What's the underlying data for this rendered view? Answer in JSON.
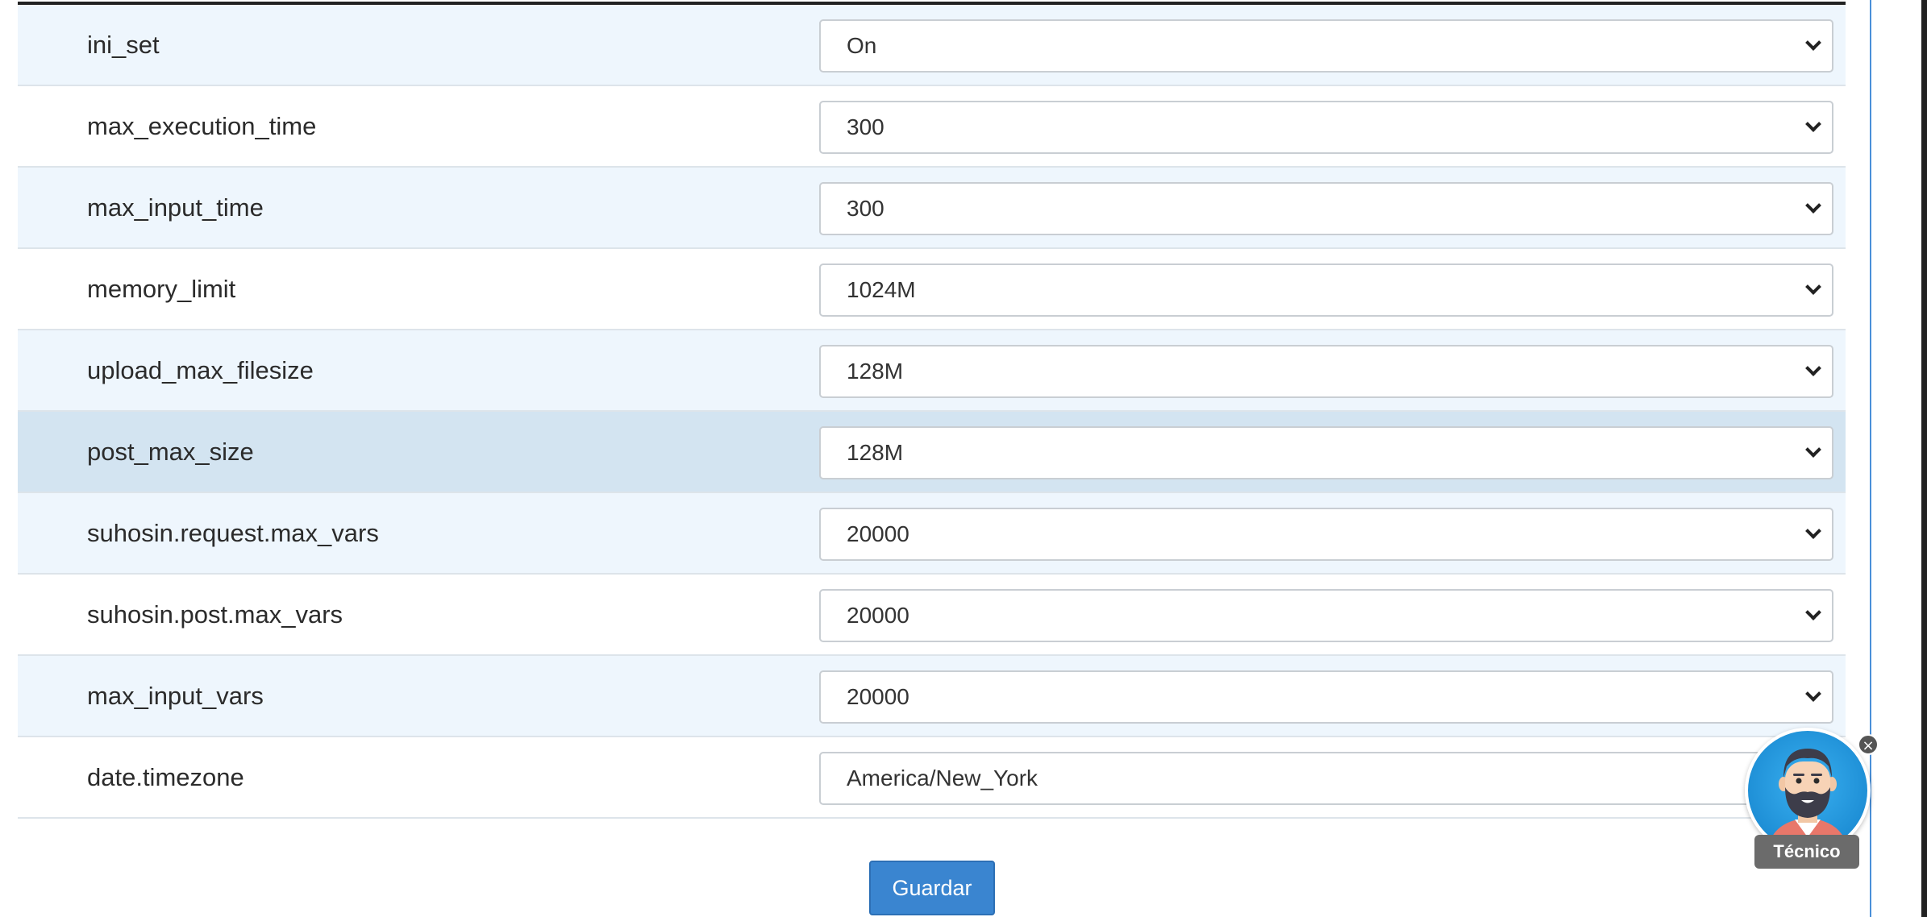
{
  "settings": {
    "rows": [
      {
        "label": "ini_set",
        "value": "On",
        "control": "select"
      },
      {
        "label": "max_execution_time",
        "value": "300",
        "control": "select"
      },
      {
        "label": "max_input_time",
        "value": "300",
        "control": "select"
      },
      {
        "label": "memory_limit",
        "value": "1024M",
        "control": "select"
      },
      {
        "label": "upload_max_filesize",
        "value": "128M",
        "control": "select"
      },
      {
        "label": "post_max_size",
        "value": "128M",
        "control": "select"
      },
      {
        "label": "suhosin.request.max_vars",
        "value": "20000",
        "control": "select"
      },
      {
        "label": "suhosin.post.max_vars",
        "value": "20000",
        "control": "select"
      },
      {
        "label": "max_input_vars",
        "value": "20000",
        "control": "select"
      },
      {
        "label": "date.timezone",
        "value": "America/New_York",
        "control": "text"
      }
    ]
  },
  "actions": {
    "save_label": "Guardar"
  },
  "assistant": {
    "label": "Técnico",
    "close_symbol": "×",
    "icon": "bearded-man-avatar-icon"
  },
  "colors": {
    "row_alt": "#eef6fd",
    "row_hover": "#d3e4f1",
    "button": "#3a85d0",
    "assistant_bg": "#1e8fd6"
  }
}
